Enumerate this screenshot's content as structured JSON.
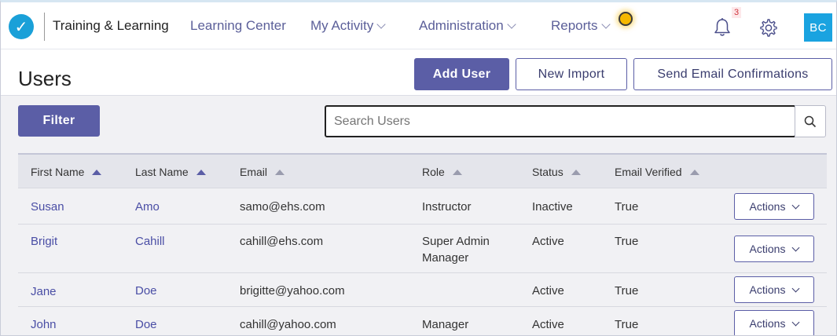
{
  "nav": {
    "logo_glyph": "✓",
    "app_title": "Training & Learning",
    "items": [
      {
        "label": "Learning Center",
        "dropdown": false
      },
      {
        "label": "My Activity",
        "dropdown": true
      },
      {
        "label": "Administration",
        "dropdown": true
      },
      {
        "label": "Reports",
        "dropdown": true
      }
    ],
    "notification_count": "3",
    "avatar_initials": "BC",
    "icons": {
      "bell": "bell-icon",
      "gear": "gear-icon"
    }
  },
  "page": {
    "title": "Users",
    "add_user_label": "Add User",
    "new_import_label": "New Import",
    "send_email_label": "Send Email Confirmations",
    "filter_label": "Filter",
    "search_placeholder": "Search Users"
  },
  "table": {
    "columns": [
      "First Name",
      "Last Name",
      "Email",
      "Role",
      "Status",
      "Email Verified"
    ],
    "actions_label": "Actions",
    "rows": [
      {
        "first": "Susan",
        "last": "Amo",
        "email": "samo@ehs.com",
        "role": "Instructor",
        "role2": "",
        "status": "Inactive",
        "verified": "True"
      },
      {
        "first": "Brigit",
        "last": "Cahill",
        "email": "cahill@ehs.com",
        "role": "Super Admin",
        "role2": "Manager",
        "status": "Active",
        "verified": "True"
      },
      {
        "first": "Jane",
        "last": "Doe",
        "email": "brigitte@yahoo.com",
        "role": "",
        "role2": "",
        "status": "Active",
        "verified": "True"
      },
      {
        "first": "John",
        "last": "Doe",
        "email": "cahill@yahoo.com",
        "role": "Manager",
        "role2": "",
        "status": "Active",
        "verified": "True"
      }
    ]
  },
  "colors": {
    "primary": "#5b5ea6",
    "link": "#4a4ea5",
    "brand": "#1aa0d8",
    "hotspot": "#f5b800"
  }
}
